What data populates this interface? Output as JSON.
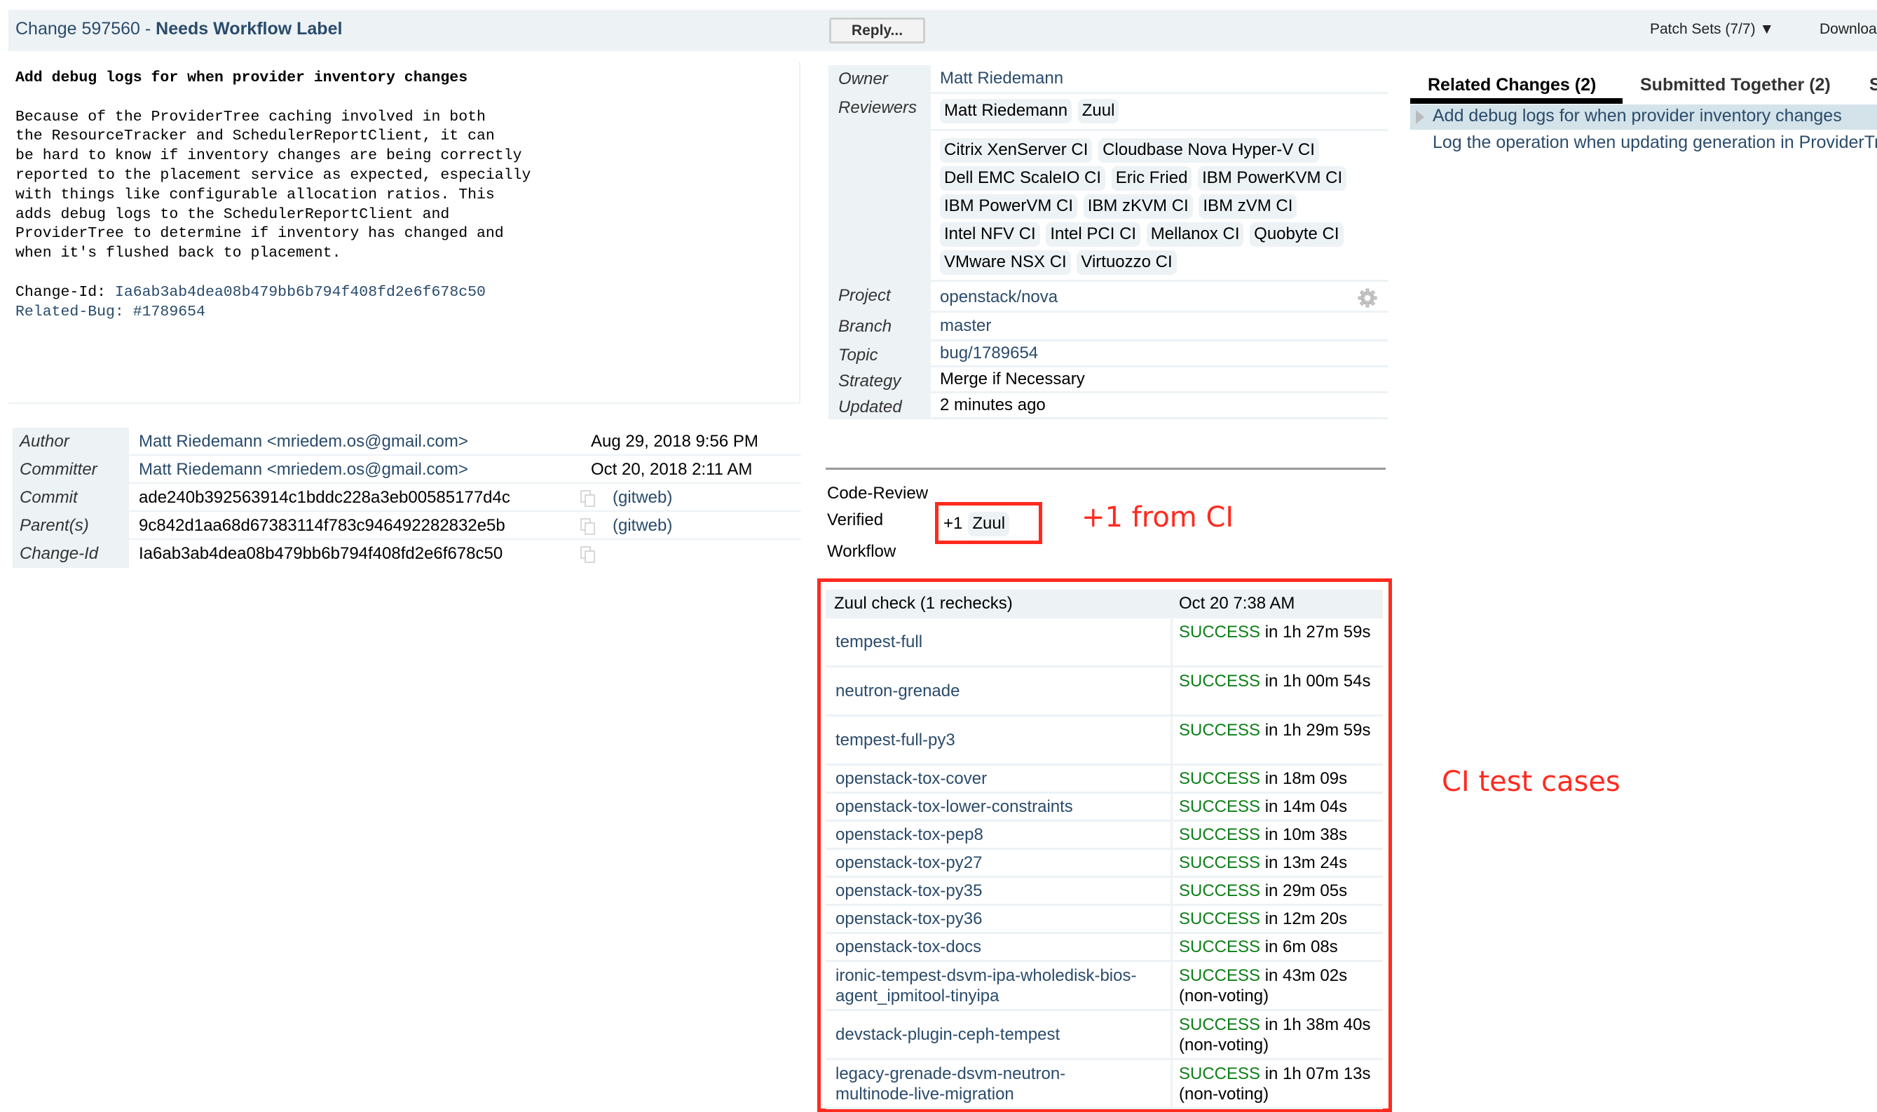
{
  "header": {
    "change_label": "Change 597560 - ",
    "status": "Needs Workflow Label",
    "reply_button": "Reply...",
    "patch_sets": "Patch Sets (7/7) ▼",
    "download": "Download"
  },
  "commit_message": {
    "subject": "Add debug logs for when provider inventory changes",
    "body": "Because of the ProviderTree caching involved in both\nthe ResourceTracker and SchedulerReportClient, it can\nbe hard to know if inventory changes are being correctly\nreported to the placement service as expected, especially\nwith things like configurable allocation ratios. This\nadds debug logs to the SchedulerReportClient and\nProviderTree to determine if inventory has changed and\nwhen it's flushed back to placement.",
    "change_id_label": "Change-Id: ",
    "change_id": "Ia6ab3ab4dea08b479bb6b794f408fd2e6f678c50",
    "related_bug": "Related-Bug: #1789654"
  },
  "commit_info": {
    "author_label": "Author",
    "author": "Matt Riedemann <mriedem.os@gmail.com>",
    "author_date": "Aug 29, 2018 9:56 PM",
    "committer_label": "Committer",
    "committer": "Matt Riedemann <mriedem.os@gmail.com>",
    "committer_date": "Oct 20, 2018 2:11 AM",
    "commit_label": "Commit",
    "commit": "ade240b392563914c1bddc228a3eb00585177d4c",
    "parents_label": "Parent(s)",
    "parent": "9c842d1aa68d67383114f783c946492282832e5b",
    "changeid_label": "Change-Id",
    "change_id": "Ia6ab3ab4dea08b479bb6b794f408fd2e6f678c50",
    "gitweb": "(gitweb)"
  },
  "info": {
    "owner_label": "Owner",
    "owner": "Matt Riedemann",
    "reviewers_label": "Reviewers",
    "reviewers": [
      "Matt Riedemann",
      "Zuul"
    ],
    "ci_reviewers": [
      "Citrix XenServer CI",
      "Cloudbase Nova Hyper-V CI",
      "Dell EMC ScaleIO CI",
      "Eric Fried",
      "IBM PowerKVM CI",
      "IBM PowerVM CI",
      "IBM zKVM CI",
      "IBM zVM CI",
      "Intel NFV CI",
      "Intel PCI CI",
      "Mellanox CI",
      "Quobyte CI",
      "VMware NSX CI",
      "Virtuozzo CI"
    ],
    "project_label": "Project",
    "project": "openstack/nova",
    "branch_label": "Branch",
    "branch": "master",
    "topic_label": "Topic",
    "topic": "bug/1789654",
    "strategy_label": "Strategy",
    "strategy": "Merge if Necessary",
    "updated_label": "Updated",
    "updated": "2 minutes ago"
  },
  "labels": {
    "code_review": "Code-Review",
    "verified": "Verified",
    "verified_score": "+1",
    "verified_by": "Zuul",
    "workflow": "Workflow"
  },
  "annotations": {
    "verified_note": "+1 from CI",
    "ci_note": "CI test cases",
    "color": "#ff2a1f"
  },
  "zuul": {
    "title": "Zuul check (1 rechecks)",
    "time": "Oct 20 7:38 AM",
    "jobs": [
      {
        "name": "tempest-full",
        "status": "SUCCESS",
        "detail": " in 1h 27m 59s"
      },
      {
        "name": "neutron-grenade",
        "status": "SUCCESS",
        "detail": " in 1h 00m 54s"
      },
      {
        "name": "tempest-full-py3",
        "status": "SUCCESS",
        "detail": " in 1h 29m 59s"
      },
      {
        "name": "openstack-tox-cover",
        "status": "SUCCESS",
        "detail": " in 18m 09s"
      },
      {
        "name": "openstack-tox-lower-constraints",
        "status": "SUCCESS",
        "detail": " in 14m 04s"
      },
      {
        "name": "openstack-tox-pep8",
        "status": "SUCCESS",
        "detail": " in 10m 38s"
      },
      {
        "name": "openstack-tox-py27",
        "status": "SUCCESS",
        "detail": " in 13m 24s"
      },
      {
        "name": "openstack-tox-py35",
        "status": "SUCCESS",
        "detail": " in 29m 05s"
      },
      {
        "name": "openstack-tox-py36",
        "status": "SUCCESS",
        "detail": " in 12m 20s"
      },
      {
        "name": "openstack-tox-docs",
        "status": "SUCCESS",
        "detail": " in 6m 08s"
      },
      {
        "name": "ironic-tempest-dsvm-ipa-wholedisk-bios-agent_ipmitool-tinyipa",
        "status": "SUCCESS",
        "detail": " in 43m 02s (non-voting)"
      },
      {
        "name": "devstack-plugin-ceph-tempest",
        "status": "SUCCESS",
        "detail": " in 1h 38m 40s (non-voting)"
      },
      {
        "name": "legacy-grenade-dsvm-neutron-multinode-live-migration",
        "status": "SUCCESS",
        "detail": " in 1h 07m 13s (non-voting)"
      }
    ]
  },
  "related": {
    "tabs": [
      "Related Changes (2)",
      "Submitted Together (2)",
      "S"
    ],
    "items": [
      "Add debug logs for when provider inventory changes",
      "Log the operation when updating generation in ProviderTree"
    ]
  }
}
